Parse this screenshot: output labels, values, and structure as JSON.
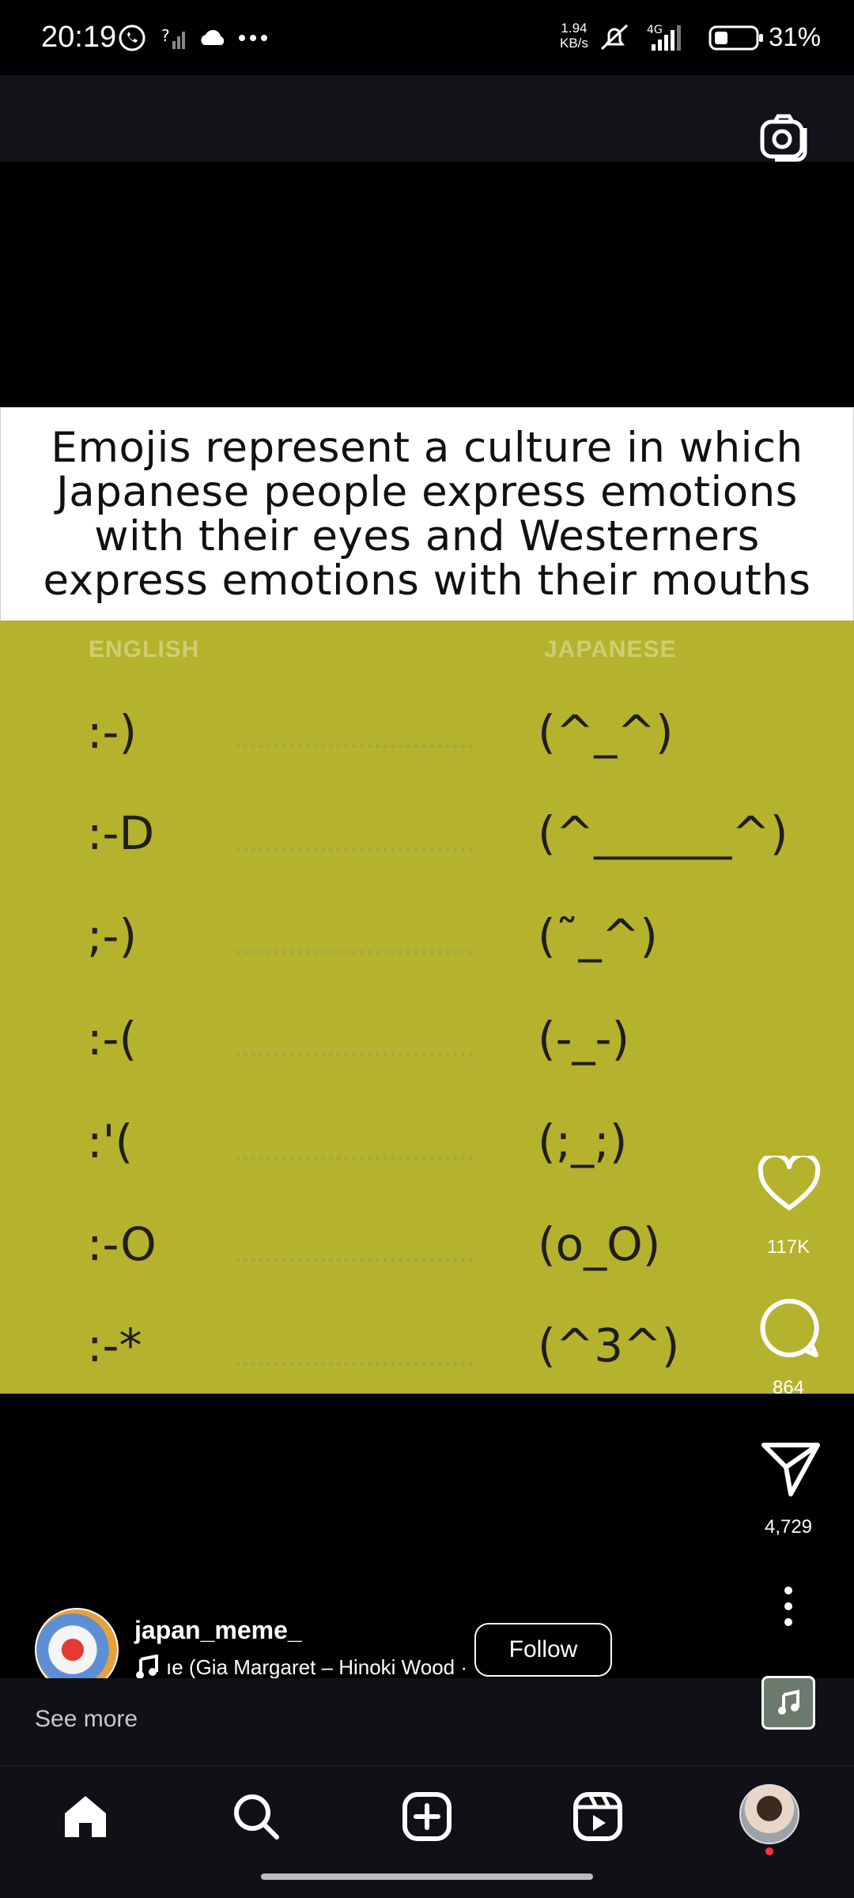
{
  "status_bar": {
    "time": "20:19",
    "net_speed_value": "1.94",
    "net_speed_unit": "KB/s",
    "network": "4G",
    "battery": "31%"
  },
  "post": {
    "caption": "Emojis represent a culture in which Japanese people express emotions with their eyes and Westerners express emotions with their mouths",
    "col_english": "ENGLISH",
    "col_japanese": "JAPANESE",
    "rows": [
      {
        "english": ":-)",
        "japanese": "(^_^)"
      },
      {
        "english": ":-D",
        "japanese": "(^______^)"
      },
      {
        "english": ";-)",
        "japanese": "(˜_^)"
      },
      {
        "english": ":-(",
        "japanese": "(-_-)"
      },
      {
        "english": ":'(",
        "japanese": "(;_;)"
      },
      {
        "english": ":-O",
        "japanese": "(o_O)"
      },
      {
        "english": ":-*",
        "japanese": "(^3^)"
      }
    ]
  },
  "actions": {
    "likes": "117K",
    "comments": "864",
    "shares": "4,729"
  },
  "author": {
    "username": "japan_meme_",
    "music": "ıe (Gia Margaret – Hinoki Wood ·",
    "follow_label": "Follow",
    "see_more": "See more"
  },
  "icons": {
    "camera": "camera-icon",
    "like": "heart-icon",
    "comment": "comment-icon",
    "share": "send-icon",
    "more": "more-vertical-icon",
    "home": "home-icon",
    "search": "search-icon",
    "create": "add-icon",
    "reels": "reels-icon"
  }
}
